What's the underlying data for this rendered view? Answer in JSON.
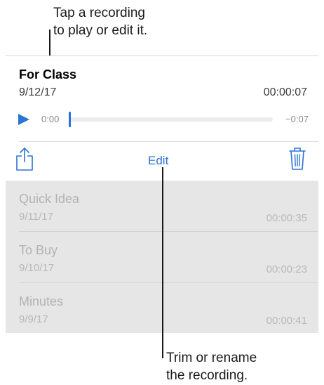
{
  "callouts": {
    "top": [
      "Tap a recording",
      "to play or edit it."
    ],
    "bottom": [
      "Trim or rename",
      "the recording."
    ]
  },
  "selected": {
    "title": "For Class",
    "date": "9/12/17",
    "duration": "00:00:07",
    "time_elapsed": "0:00",
    "time_remaining": "−0:07",
    "progress": 0.0
  },
  "toolbar": {
    "edit_label": "Edit",
    "share_icon": "share-icon",
    "trash_icon": "trash-icon"
  },
  "recordings": [
    {
      "title": "Quick Idea",
      "date": "9/11/17",
      "duration": "00:00:35"
    },
    {
      "title": "To Buy",
      "date": "9/10/17",
      "duration": "00:00:23"
    },
    {
      "title": "Minutes",
      "date": "9/9/17",
      "duration": "00:00:41"
    }
  ],
  "colors": {
    "accent": "#2b73d4",
    "list_background": "#e6e6e6",
    "dimmed_text": "#b3b3b3"
  }
}
